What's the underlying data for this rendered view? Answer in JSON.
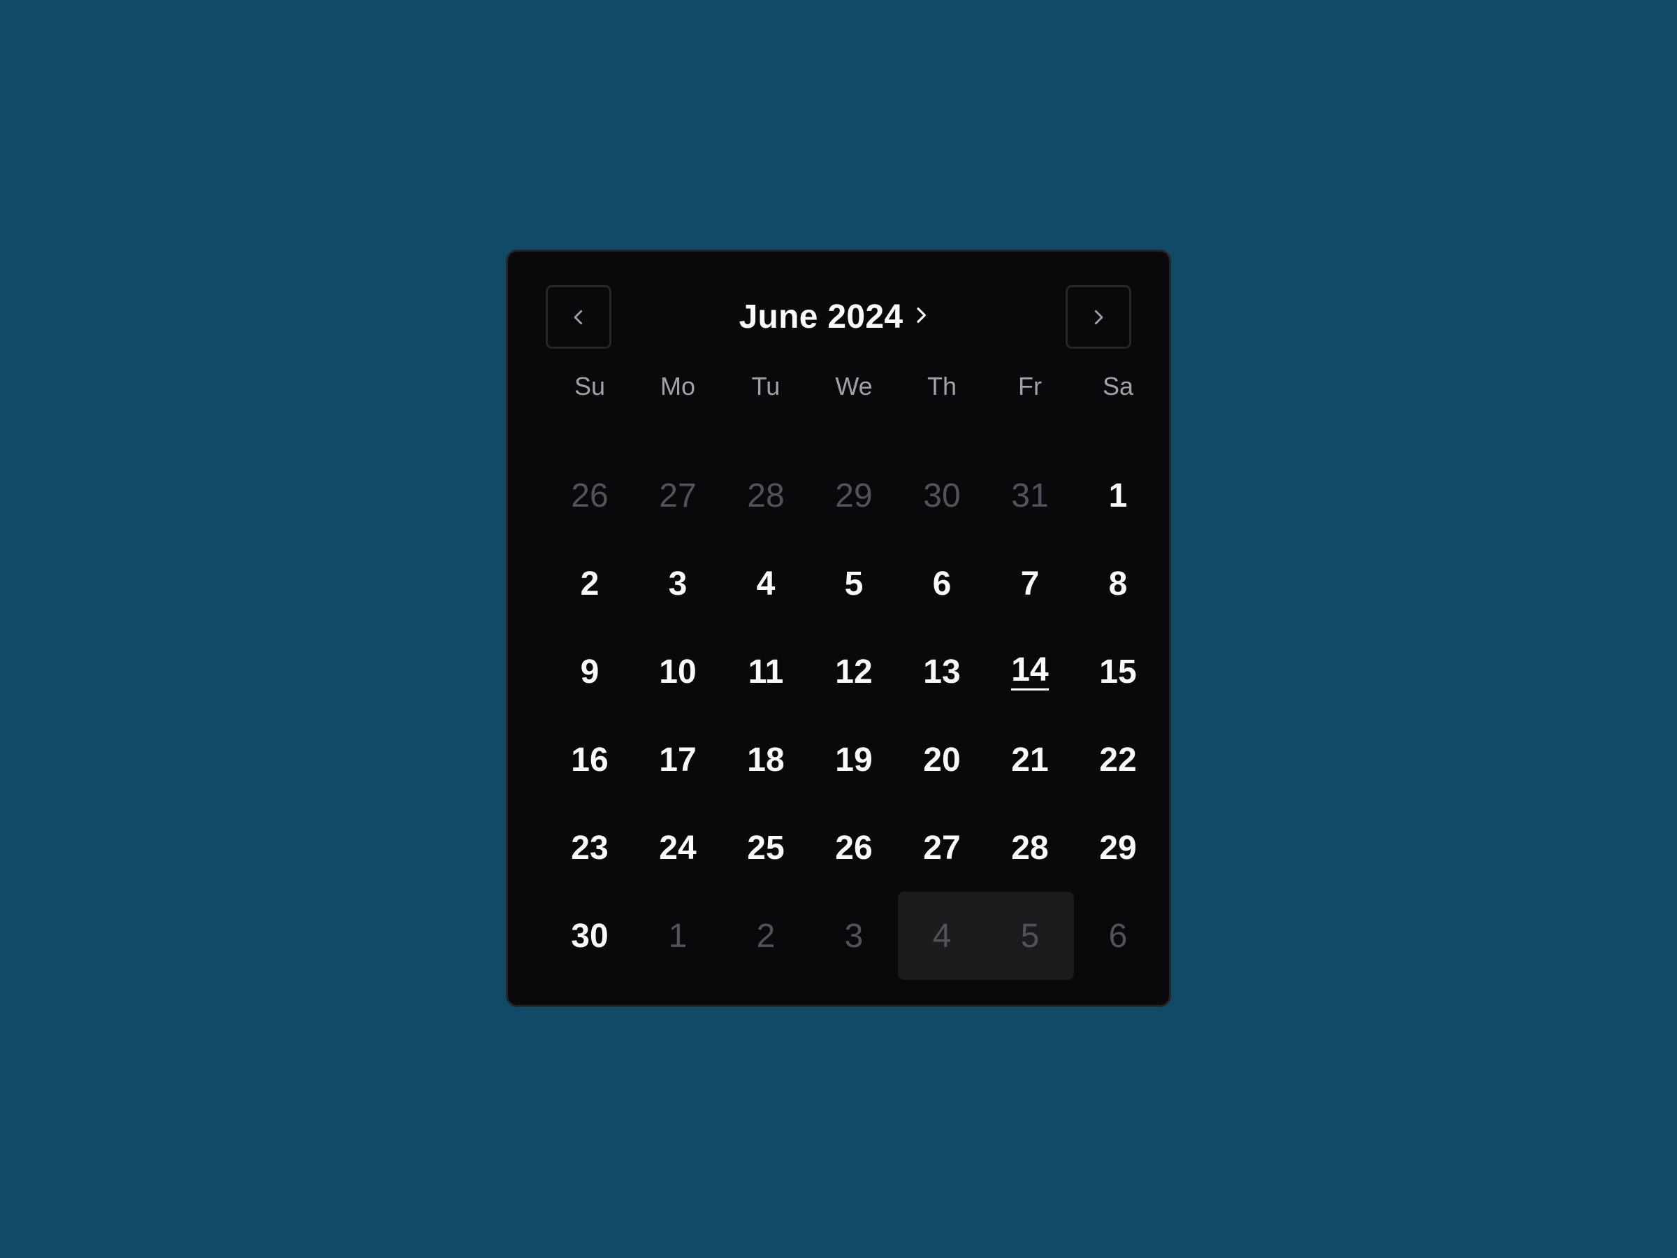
{
  "calendar": {
    "caption": "June 2024",
    "weekdays": [
      "Su",
      "Mo",
      "Tu",
      "We",
      "Th",
      "Fr",
      "Sa"
    ],
    "weeks": [
      [
        {
          "d": "26",
          "outside": true
        },
        {
          "d": "27",
          "outside": true
        },
        {
          "d": "28",
          "outside": true
        },
        {
          "d": "29",
          "outside": true
        },
        {
          "d": "30",
          "outside": true
        },
        {
          "d": "31",
          "outside": true
        },
        {
          "d": "1"
        }
      ],
      [
        {
          "d": "2"
        },
        {
          "d": "3"
        },
        {
          "d": "4"
        },
        {
          "d": "5"
        },
        {
          "d": "6"
        },
        {
          "d": "7"
        },
        {
          "d": "8"
        }
      ],
      [
        {
          "d": "9"
        },
        {
          "d": "10"
        },
        {
          "d": "11"
        },
        {
          "d": "12"
        },
        {
          "d": "13"
        },
        {
          "d": "14",
          "today": true
        },
        {
          "d": "15"
        }
      ],
      [
        {
          "d": "16"
        },
        {
          "d": "17"
        },
        {
          "d": "18"
        },
        {
          "d": "19"
        },
        {
          "d": "20"
        },
        {
          "d": "21"
        },
        {
          "d": "22"
        }
      ],
      [
        {
          "d": "23"
        },
        {
          "d": "24"
        },
        {
          "d": "25"
        },
        {
          "d": "26"
        },
        {
          "d": "27"
        },
        {
          "d": "28"
        },
        {
          "d": "29"
        }
      ],
      [
        {
          "d": "30"
        },
        {
          "d": "1",
          "outside": true
        },
        {
          "d": "2",
          "outside": true
        },
        {
          "d": "3",
          "outside": true
        },
        {
          "d": "4",
          "outside": true,
          "in_range": true
        },
        {
          "d": "5",
          "outside": true,
          "in_range": true
        },
        {
          "d": "6",
          "outside": true
        }
      ]
    ],
    "icons": {
      "prev": "chevron-left-icon",
      "next": "chevron-right-icon",
      "caption": "chevron-right-icon"
    },
    "colors": {
      "background": "#114a66",
      "panel": "#09090b",
      "border": "#27272a",
      "text": "#fafafa",
      "muted": "#a1a1aa",
      "outside": "#52525b",
      "range": "#1c1c1f"
    }
  }
}
